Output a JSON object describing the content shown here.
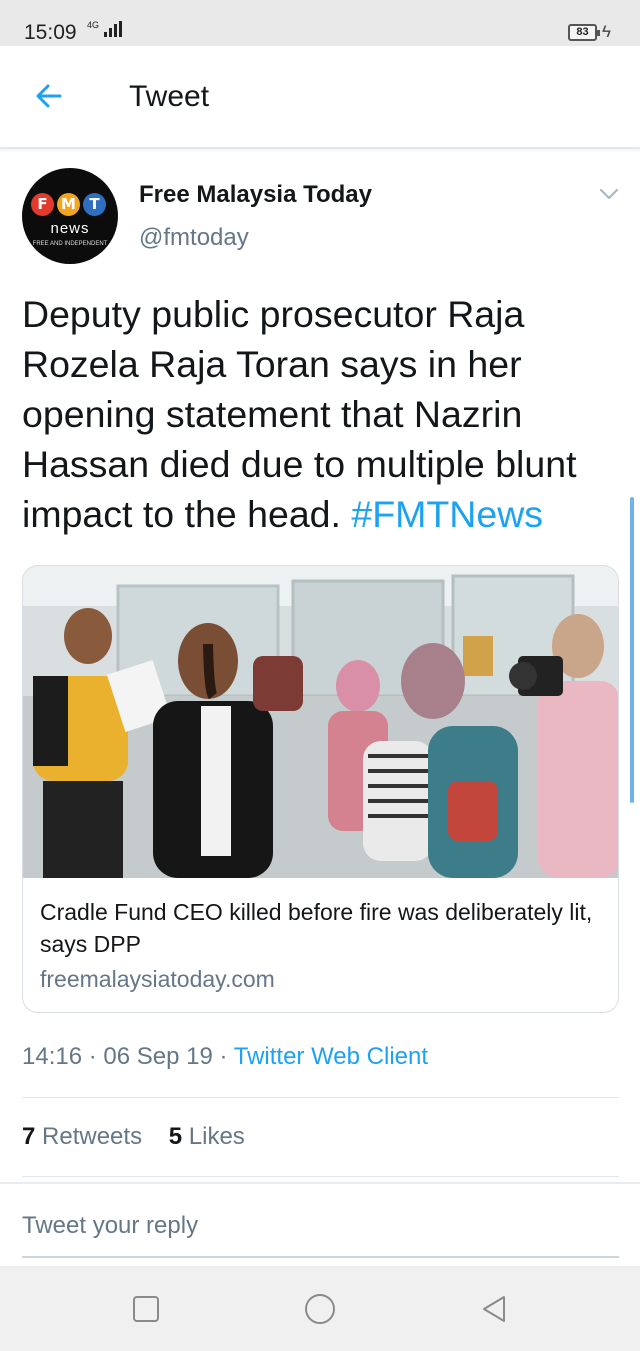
{
  "status_bar": {
    "time": "15:09",
    "network": "4G",
    "battery": "83"
  },
  "header": {
    "title": "Tweet",
    "back_icon": "arrow-left-icon"
  },
  "tweet": {
    "author_name": "Free Malaysia Today",
    "author_handle": "@fmtoday",
    "avatar": {
      "letters": [
        "F",
        "M",
        "T"
      ],
      "word": "news",
      "tagline": "FREE AND INDEPENDENT"
    },
    "text": "Deputy public prosecutor Raja Rozela Raja Toran says in her opening statement that Nazrin Hassan died due to multiple blunt impact to the head.",
    "hashtag": "#FMTNews",
    "card": {
      "title": "Cradle Fund CEO killed before fire was deliberately lit, says DPP",
      "domain": "freemalaysiatoday.com"
    },
    "time": "14:16",
    "date": "06 Sep 19",
    "client": "Twitter Web Client",
    "retweets": "7",
    "retweets_label": "Retweets",
    "likes": "5",
    "likes_label": "Likes"
  },
  "reply": {
    "placeholder": "Tweet your reply"
  },
  "colors": {
    "link": "#1da1f2",
    "secondary_text": "#657786",
    "primary_text": "#14171a"
  }
}
